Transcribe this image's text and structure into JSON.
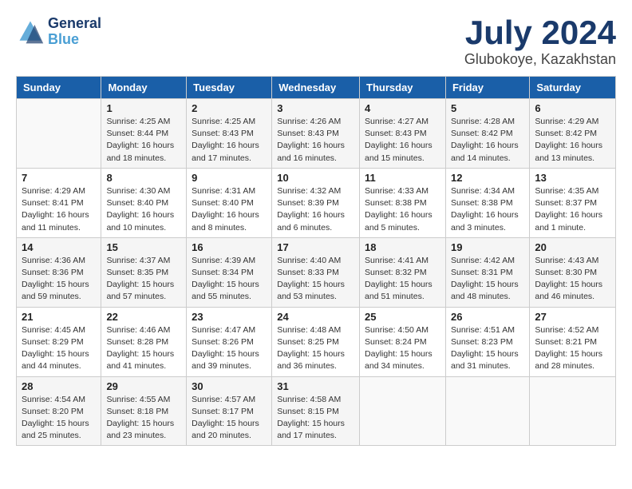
{
  "header": {
    "logo_line1": "General",
    "logo_line2": "Blue",
    "month": "July 2024",
    "location": "Glubokoye, Kazakhstan"
  },
  "weekdays": [
    "Sunday",
    "Monday",
    "Tuesday",
    "Wednesday",
    "Thursday",
    "Friday",
    "Saturday"
  ],
  "weeks": [
    [
      {
        "day": "",
        "sunrise": "",
        "sunset": "",
        "daylight": ""
      },
      {
        "day": "1",
        "sunrise": "Sunrise: 4:25 AM",
        "sunset": "Sunset: 8:44 PM",
        "daylight": "Daylight: 16 hours and 18 minutes."
      },
      {
        "day": "2",
        "sunrise": "Sunrise: 4:25 AM",
        "sunset": "Sunset: 8:43 PM",
        "daylight": "Daylight: 16 hours and 17 minutes."
      },
      {
        "day": "3",
        "sunrise": "Sunrise: 4:26 AM",
        "sunset": "Sunset: 8:43 PM",
        "daylight": "Daylight: 16 hours and 16 minutes."
      },
      {
        "day": "4",
        "sunrise": "Sunrise: 4:27 AM",
        "sunset": "Sunset: 8:43 PM",
        "daylight": "Daylight: 16 hours and 15 minutes."
      },
      {
        "day": "5",
        "sunrise": "Sunrise: 4:28 AM",
        "sunset": "Sunset: 8:42 PM",
        "daylight": "Daylight: 16 hours and 14 minutes."
      },
      {
        "day": "6",
        "sunrise": "Sunrise: 4:29 AM",
        "sunset": "Sunset: 8:42 PM",
        "daylight": "Daylight: 16 hours and 13 minutes."
      }
    ],
    [
      {
        "day": "7",
        "sunrise": "Sunrise: 4:29 AM",
        "sunset": "Sunset: 8:41 PM",
        "daylight": "Daylight: 16 hours and 11 minutes."
      },
      {
        "day": "8",
        "sunrise": "Sunrise: 4:30 AM",
        "sunset": "Sunset: 8:40 PM",
        "daylight": "Daylight: 16 hours and 10 minutes."
      },
      {
        "day": "9",
        "sunrise": "Sunrise: 4:31 AM",
        "sunset": "Sunset: 8:40 PM",
        "daylight": "Daylight: 16 hours and 8 minutes."
      },
      {
        "day": "10",
        "sunrise": "Sunrise: 4:32 AM",
        "sunset": "Sunset: 8:39 PM",
        "daylight": "Daylight: 16 hours and 6 minutes."
      },
      {
        "day": "11",
        "sunrise": "Sunrise: 4:33 AM",
        "sunset": "Sunset: 8:38 PM",
        "daylight": "Daylight: 16 hours and 5 minutes."
      },
      {
        "day": "12",
        "sunrise": "Sunrise: 4:34 AM",
        "sunset": "Sunset: 8:38 PM",
        "daylight": "Daylight: 16 hours and 3 minutes."
      },
      {
        "day": "13",
        "sunrise": "Sunrise: 4:35 AM",
        "sunset": "Sunset: 8:37 PM",
        "daylight": "Daylight: 16 hours and 1 minute."
      }
    ],
    [
      {
        "day": "14",
        "sunrise": "Sunrise: 4:36 AM",
        "sunset": "Sunset: 8:36 PM",
        "daylight": "Daylight: 15 hours and 59 minutes."
      },
      {
        "day": "15",
        "sunrise": "Sunrise: 4:37 AM",
        "sunset": "Sunset: 8:35 PM",
        "daylight": "Daylight: 15 hours and 57 minutes."
      },
      {
        "day": "16",
        "sunrise": "Sunrise: 4:39 AM",
        "sunset": "Sunset: 8:34 PM",
        "daylight": "Daylight: 15 hours and 55 minutes."
      },
      {
        "day": "17",
        "sunrise": "Sunrise: 4:40 AM",
        "sunset": "Sunset: 8:33 PM",
        "daylight": "Daylight: 15 hours and 53 minutes."
      },
      {
        "day": "18",
        "sunrise": "Sunrise: 4:41 AM",
        "sunset": "Sunset: 8:32 PM",
        "daylight": "Daylight: 15 hours and 51 minutes."
      },
      {
        "day": "19",
        "sunrise": "Sunrise: 4:42 AM",
        "sunset": "Sunset: 8:31 PM",
        "daylight": "Daylight: 15 hours and 48 minutes."
      },
      {
        "day": "20",
        "sunrise": "Sunrise: 4:43 AM",
        "sunset": "Sunset: 8:30 PM",
        "daylight": "Daylight: 15 hours and 46 minutes."
      }
    ],
    [
      {
        "day": "21",
        "sunrise": "Sunrise: 4:45 AM",
        "sunset": "Sunset: 8:29 PM",
        "daylight": "Daylight: 15 hours and 44 minutes."
      },
      {
        "day": "22",
        "sunrise": "Sunrise: 4:46 AM",
        "sunset": "Sunset: 8:28 PM",
        "daylight": "Daylight: 15 hours and 41 minutes."
      },
      {
        "day": "23",
        "sunrise": "Sunrise: 4:47 AM",
        "sunset": "Sunset: 8:26 PM",
        "daylight": "Daylight: 15 hours and 39 minutes."
      },
      {
        "day": "24",
        "sunrise": "Sunrise: 4:48 AM",
        "sunset": "Sunset: 8:25 PM",
        "daylight": "Daylight: 15 hours and 36 minutes."
      },
      {
        "day": "25",
        "sunrise": "Sunrise: 4:50 AM",
        "sunset": "Sunset: 8:24 PM",
        "daylight": "Daylight: 15 hours and 34 minutes."
      },
      {
        "day": "26",
        "sunrise": "Sunrise: 4:51 AM",
        "sunset": "Sunset: 8:23 PM",
        "daylight": "Daylight: 15 hours and 31 minutes."
      },
      {
        "day": "27",
        "sunrise": "Sunrise: 4:52 AM",
        "sunset": "Sunset: 8:21 PM",
        "daylight": "Daylight: 15 hours and 28 minutes."
      }
    ],
    [
      {
        "day": "28",
        "sunrise": "Sunrise: 4:54 AM",
        "sunset": "Sunset: 8:20 PM",
        "daylight": "Daylight: 15 hours and 25 minutes."
      },
      {
        "day": "29",
        "sunrise": "Sunrise: 4:55 AM",
        "sunset": "Sunset: 8:18 PM",
        "daylight": "Daylight: 15 hours and 23 minutes."
      },
      {
        "day": "30",
        "sunrise": "Sunrise: 4:57 AM",
        "sunset": "Sunset: 8:17 PM",
        "daylight": "Daylight: 15 hours and 20 minutes."
      },
      {
        "day": "31",
        "sunrise": "Sunrise: 4:58 AM",
        "sunset": "Sunset: 8:15 PM",
        "daylight": "Daylight: 15 hours and 17 minutes."
      },
      {
        "day": "",
        "sunrise": "",
        "sunset": "",
        "daylight": ""
      },
      {
        "day": "",
        "sunrise": "",
        "sunset": "",
        "daylight": ""
      },
      {
        "day": "",
        "sunrise": "",
        "sunset": "",
        "daylight": ""
      }
    ]
  ]
}
